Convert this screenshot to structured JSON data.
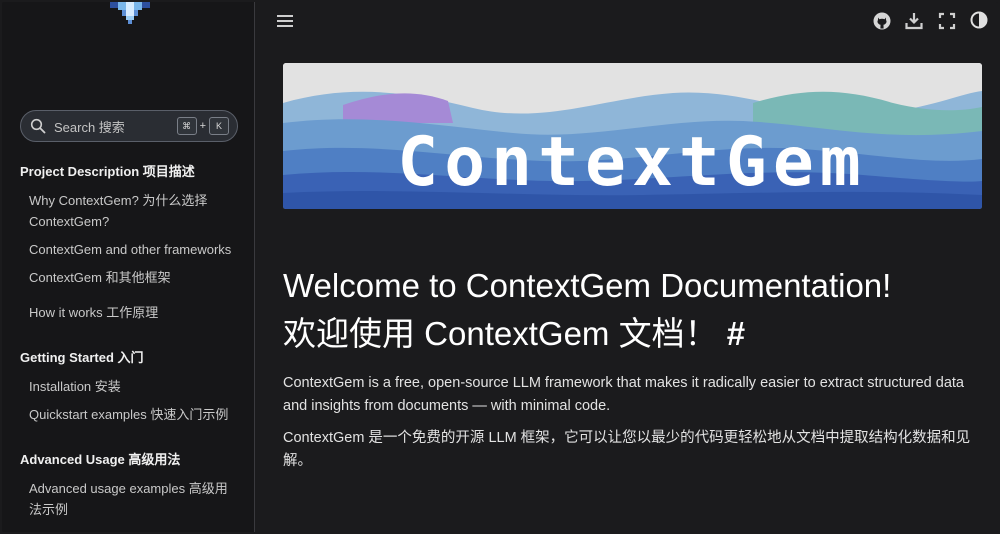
{
  "sidebar": {
    "search": {
      "placeholder": "Search  搜索",
      "key1": "⌘",
      "plus": "+",
      "key2": "K"
    },
    "sections": [
      {
        "caption": "Project Description  项目描述",
        "links": [
          "Why ContextGem?  为什么选择 ContextGem?",
          "ContextGem and other frameworks",
          "ContextGem 和其他框架",
          "How it works  工作原理"
        ]
      },
      {
        "caption": "Getting Started  入门",
        "links": [
          "Installation  安装",
          "Quickstart examples  快速入门示例"
        ]
      },
      {
        "caption": "Advanced Usage  高级用法",
        "links": [
          "Advanced usage examples  高级用法示例"
        ]
      }
    ]
  },
  "topbar": {
    "icons": [
      "menu-icon",
      "github-icon",
      "download-icon",
      "fullscreen-icon",
      "theme-toggle-icon"
    ]
  },
  "banner": {
    "text": "ContextGem"
  },
  "main": {
    "heading_line1": "Welcome to ContextGem Documentation!",
    "heading_line2": "欢迎使用 ContextGem 文档！",
    "anchor": "#",
    "para1": "ContextGem is a free, open-source LLM framework that makes it radically easier to extract structured data and insights from documents — with minimal code.",
    "para2": "ContextGem 是一个免费的开源 LLM 框架，它可以让您以最少的代码更轻松地从文档中提取结构化数据和见解。"
  },
  "colors": {
    "background": "#1b1b1d",
    "sidebar": "#161618",
    "text": "#e6e6e6"
  }
}
